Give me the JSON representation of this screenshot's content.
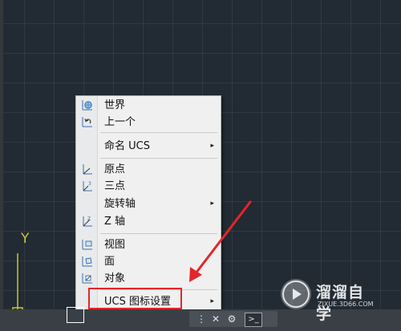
{
  "axis_label": "Y",
  "menu": {
    "items": [
      {
        "label": "世界",
        "icon": "world-ucs-icon"
      },
      {
        "label": "上一个",
        "icon": "previous-ucs-icon"
      },
      {
        "label": "命名 UCS",
        "icon": "",
        "submenu": true
      },
      {
        "label": "原点",
        "icon": "origin-ucs-icon"
      },
      {
        "label": "三点",
        "icon": "three-point-ucs-icon"
      },
      {
        "label": "旋转轴",
        "icon": "",
        "submenu": true
      },
      {
        "label": "Z 轴",
        "icon": "z-axis-ucs-icon"
      },
      {
        "label": "视图",
        "icon": "view-ucs-icon"
      },
      {
        "label": "面",
        "icon": "face-ucs-icon"
      },
      {
        "label": "对象",
        "icon": "object-ucs-icon"
      },
      {
        "label": "UCS 图标设置",
        "icon": "",
        "submenu": true
      }
    ],
    "arrow": "▸"
  },
  "watermark": {
    "title": "溜溜自学",
    "subtitle": "ZIXUE.3D66.COM"
  },
  "status_bar": {
    "cmd_icon": ">_"
  },
  "colors": {
    "canvas_bg": "#222a33",
    "ucs_yellow": "#c9c43a",
    "highlight_red": "#e3262a",
    "menu_bg": "#f0f0f0"
  }
}
